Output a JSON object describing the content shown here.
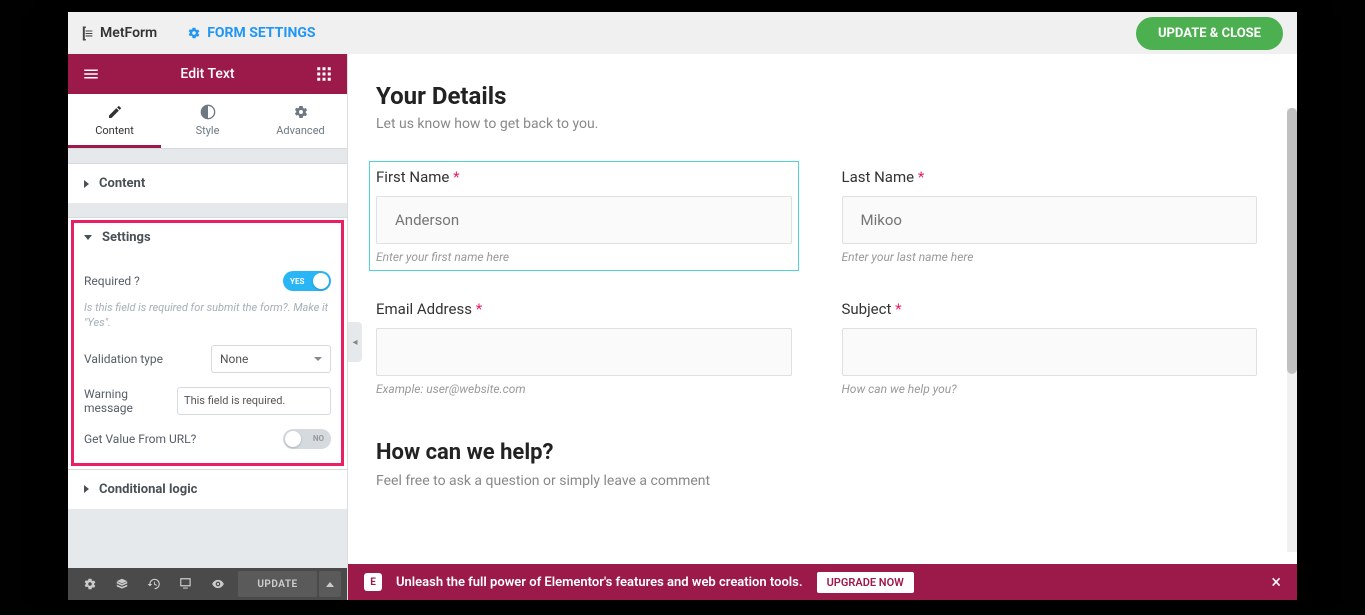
{
  "topbar": {
    "brand": "MetForm",
    "form_settings": "FORM SETTINGS",
    "update_close": "UPDATE & CLOSE"
  },
  "panel": {
    "title": "Edit Text",
    "tabs": {
      "content": "Content",
      "style": "Style",
      "advanced": "Advanced"
    }
  },
  "sections": {
    "content": "Content",
    "settings": "Settings",
    "conditional": "Conditional logic"
  },
  "settings": {
    "required_label": "Required ?",
    "required_on_text": "YES",
    "required_desc": "Is this field is required for submit the form?. Make it \"Yes\".",
    "validation_label": "Validation type",
    "validation_value": "None",
    "warning_label": "Warning message",
    "warning_value": "This field is required.",
    "geturl_label": "Get Value From URL?",
    "geturl_off_text": "NO"
  },
  "footer": {
    "update": "UPDATE"
  },
  "form": {
    "title": "Your Details",
    "subtitle": "Let us know how to get back to you.",
    "first_name": {
      "label": "First Name",
      "placeholder": "Anderson",
      "hint": "Enter your first name here"
    },
    "last_name": {
      "label": "Last Name",
      "placeholder": "Mikoo",
      "hint": "Enter your last name here"
    },
    "email": {
      "label": "Email Address",
      "hint": "Example: user@website.com"
    },
    "subject": {
      "label": "Subject",
      "hint": "How can we help you?"
    },
    "help_title": "How can we help?",
    "help_subtitle": "Feel free to ask a question or simply leave a comment"
  },
  "promo": {
    "text": "Unleash the full power of Elementor's features and web creation tools.",
    "cta": "UPGRADE NOW"
  }
}
